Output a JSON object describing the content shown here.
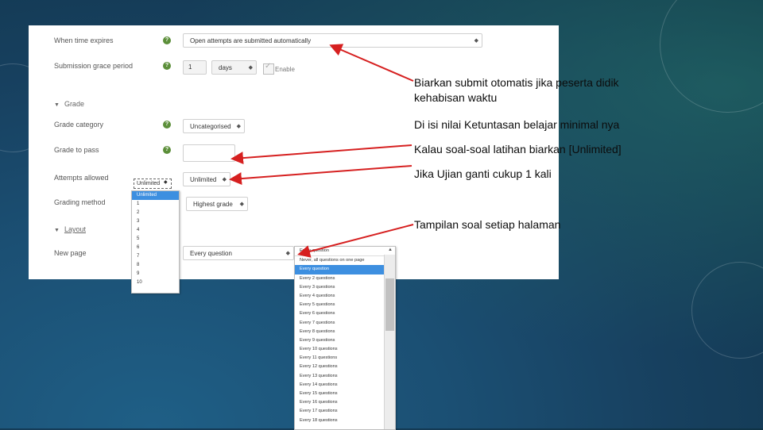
{
  "form": {
    "when_time_expires": {
      "label": "When time expires",
      "value": "Open attempts are submitted automatically"
    },
    "grace_period": {
      "label": "Submission grace period",
      "number": "1",
      "unit": "days",
      "enable_label": "Enable"
    },
    "grade_section": "Grade",
    "grade_category": {
      "label": "Grade category",
      "value": "Uncategorised"
    },
    "grade_to_pass": {
      "label": "Grade to pass",
      "value": ""
    },
    "attempts_allowed": {
      "label": "Attempts allowed",
      "value": "Unlimited"
    },
    "grading_method": {
      "label": "Grading method",
      "value": "Highest grade"
    },
    "layout_section": "Layout",
    "new_page": {
      "label": "New page",
      "value": "Every question"
    }
  },
  "attempts_dropdown": {
    "current": "Unlimited",
    "options": [
      "Unlimited",
      "1",
      "2",
      "3",
      "4",
      "5",
      "6",
      "7",
      "8",
      "9",
      "10"
    ],
    "selected_index": 0
  },
  "newpage_dropdown": {
    "current": "Every question",
    "options": [
      "Never, all questions on one page",
      "Every question",
      "Every 2 questions",
      "Every 3 questions",
      "Every 4 questions",
      "Every 5 questions",
      "Every 6 questions",
      "Every 7 questions",
      "Every 8 questions",
      "Every 9 questions",
      "Every 10 questions",
      "Every 11 questions",
      "Every 12 questions",
      "Every 13 questions",
      "Every 14 questions",
      "Every 15 questions",
      "Every 16 questions",
      "Every 17 questions",
      "Every 18 questions"
    ],
    "selected_index": 1
  },
  "annotations": {
    "note1_line1": "Biarkan submit otomatis jika peserta didik",
    "note1_line2": "kehabisan waktu",
    "note2": "Di isi nilai Ketuntasan belajar minimal nya",
    "note3": "Kalau soal-soal latihan biarkan [Unlimited]",
    "note4": "Jika Ujian ganti cukup 1 kali",
    "note5": "Tampilan soal setiap halaman"
  },
  "colors": {
    "arrow": "#d62020",
    "help_icon": "#5c8f3a",
    "selected_option": "#3d8fe0"
  }
}
